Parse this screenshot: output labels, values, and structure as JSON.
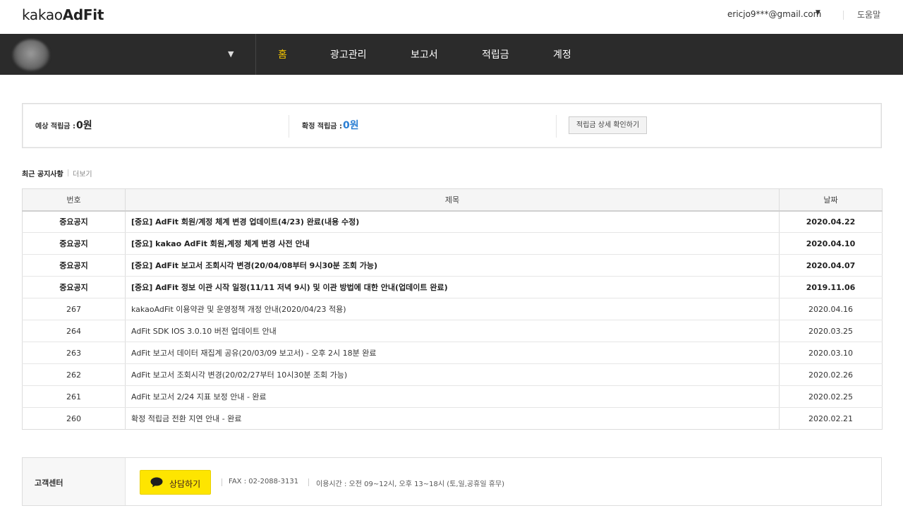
{
  "header": {
    "logo_part1": "kakao",
    "logo_part2": "AdFit",
    "account_email": "ericjo9***@gmail.com",
    "account_caret": "▼",
    "help": "도움말"
  },
  "nav": {
    "site_caret": "▼",
    "items": [
      {
        "label": "홈",
        "active": true
      },
      {
        "label": "광고관리",
        "active": false
      },
      {
        "label": "보고서",
        "active": false
      },
      {
        "label": "적립금",
        "active": false
      },
      {
        "label": "계정",
        "active": false
      }
    ],
    "active_color": "#f6c700"
  },
  "earnings": {
    "expected_label": "예상 적립금 :",
    "expected_value": "0원",
    "confirmed_label": "확정 적립금 :",
    "confirmed_value": "0원",
    "detail_button": "적립금 상세 확인하기"
  },
  "notices": {
    "title": "최근 공지사항",
    "more": "더보기",
    "columns": [
      "번호",
      "제목",
      "날짜"
    ],
    "rows": [
      {
        "no": "중요공지",
        "title": "[중요] AdFit 회원/계정 체계 변경 업데이트(4/23) 완료(내용 수정)",
        "date": "2020.04.22",
        "important": true
      },
      {
        "no": "중요공지",
        "title": "[중요] kakao AdFit 회원,계정 체계 변경 사전 안내",
        "date": "2020.04.10",
        "important": true
      },
      {
        "no": "중요공지",
        "title": "[중요] AdFit 보고서 조회시각 변경(20/04/08부터 9시30분 조회 가능)",
        "date": "2020.04.07",
        "important": true
      },
      {
        "no": "중요공지",
        "title": "[중요] AdFit 정보 이관 시작 일정(11/11 저녁 9시) 및 이관 방법에 대한 안내(업데이트 완료)",
        "date": "2019.11.06",
        "important": true
      },
      {
        "no": "267",
        "title": "kakaoAdFit 이용약관 및 운영정책 개정 안내(2020/04/23 적용)",
        "date": "2020.04.16",
        "important": false
      },
      {
        "no": "264",
        "title": "AdFit SDK IOS 3.0.10 버전 업데이트 안내",
        "date": "2020.03.25",
        "important": false
      },
      {
        "no": "263",
        "title": "AdFit 보고서 데이터 재집계 공유(20/03/09 보고서) - 오후 2시 18분 완료",
        "date": "2020.03.10",
        "important": false
      },
      {
        "no": "262",
        "title": "AdFit 보고서 조회시각 변경(20/02/27부터 10시30분 조회 가능)",
        "date": "2020.02.26",
        "important": false
      },
      {
        "no": "261",
        "title": "AdFit 보고서 2/24 지표 보정 안내 - 완료",
        "date": "2020.02.25",
        "important": false
      },
      {
        "no": "260",
        "title": "확정 적립금 전환 지연 안내 - 완료",
        "date": "2020.02.21",
        "important": false
      }
    ]
  },
  "footer": {
    "label": "고객센터",
    "consult_button": "상담하기",
    "fax": "FAX : 02-2088-3131",
    "hours": "이용시간 : 오전 09~12시, 오후 13~18시 (토,일,공휴일 휴무)",
    "consult_color": "#fee500"
  },
  "icons": [
    "chat-bubble-icon",
    "caret-down-icon",
    "avatar"
  ]
}
